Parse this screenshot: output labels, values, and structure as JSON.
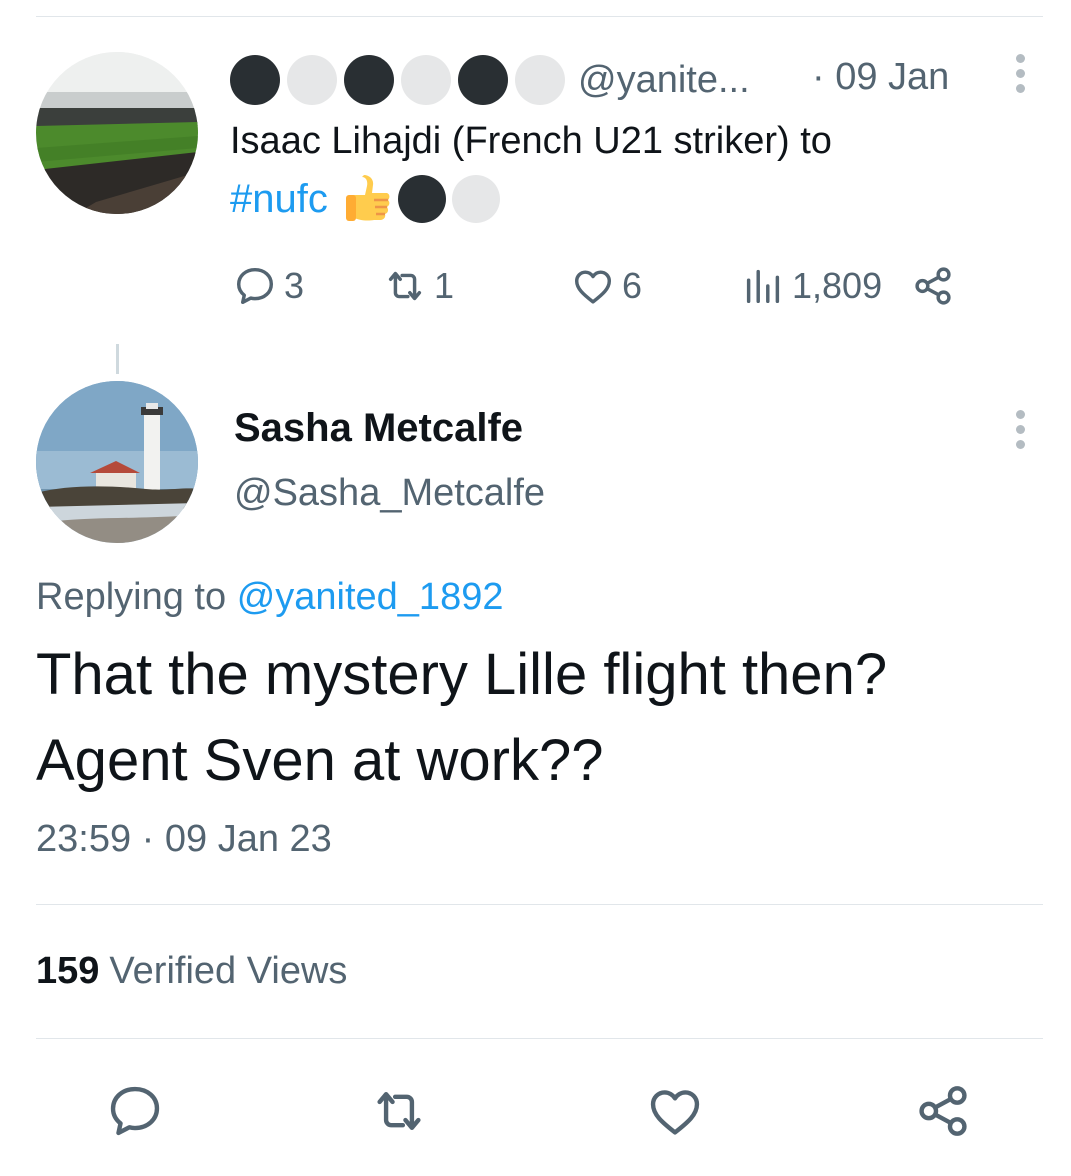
{
  "parent_tweet": {
    "handle": "@yanite...",
    "date": "· 09 Jan",
    "text_line1": "Isaac Lihajdi (French U21 striker) to",
    "hashtag": "#nufc",
    "name_emoji": [
      "black-circle",
      "white-circle",
      "black-circle",
      "white-circle",
      "black-circle",
      "white-circle"
    ],
    "trailing_emoji": [
      "thumbs-up",
      "black-circle",
      "white-circle"
    ],
    "actions": {
      "replies": "3",
      "retweets": "1",
      "likes": "6",
      "views": "1,809"
    }
  },
  "reply_tweet": {
    "display_name": "Sasha Metcalfe",
    "handle": "@Sasha_Metcalfe",
    "replying_label": "Replying to",
    "replying_to": "@yanited_1892",
    "text_line1": "That the mystery Lille flight then?",
    "text_line2": "Agent Sven at work??",
    "timestamp": "23:59 · 09 Jan 23",
    "verified_views_count": "159",
    "verified_views_label": "Verified Views"
  },
  "icons": {
    "reply": "reply-bubble-icon",
    "retweet": "retweet-icon",
    "like": "heart-icon",
    "views": "views-bar-chart-icon",
    "share": "share-icon",
    "more": "more-vertical-icon"
  },
  "colors": {
    "accent": "#1d9bf0",
    "text_primary": "#0f1419",
    "text_secondary": "#536471",
    "divider": "#e1e6ea"
  }
}
